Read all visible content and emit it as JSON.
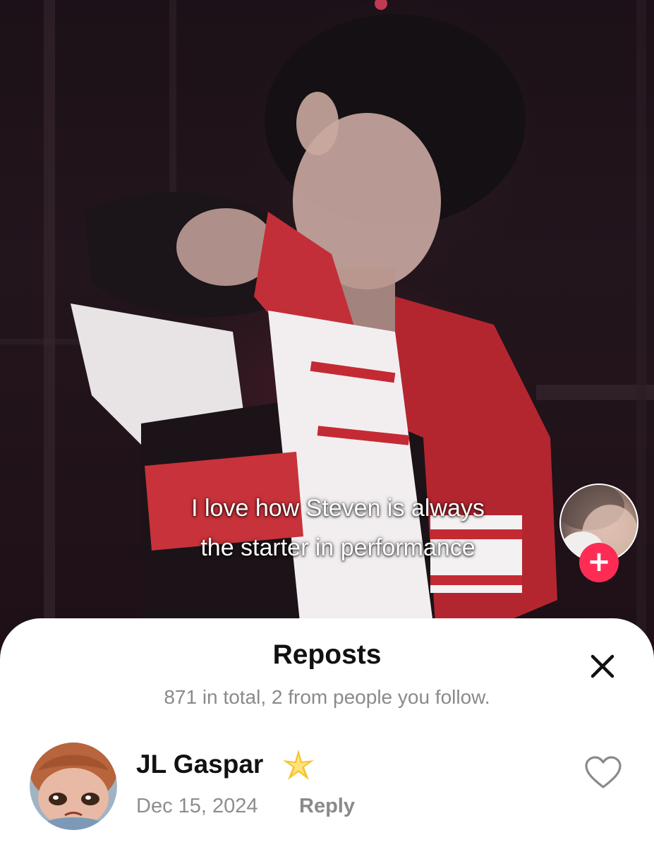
{
  "video": {
    "caption_line1": "I love how Steven is always",
    "caption_line2": "the starter in performance",
    "creator_avatar_icon": "creator-avatar-photo",
    "follow_icon": "plus-icon",
    "follow_color": "#fe2c55"
  },
  "sheet": {
    "title": "Reposts",
    "subtitle": "871 in total, 2 from people you follow.",
    "close_icon": "close-icon"
  },
  "reposts": [
    {
      "name": "JL Gaspar",
      "badge_icon": "sparkle-star-icon",
      "date": "Dec 15, 2024",
      "reply_label": "Reply",
      "like_icon": "heart-outline-icon"
    }
  ],
  "colors": {
    "accent": "#fe2c55",
    "text_primary": "#111111",
    "text_secondary": "#8a8a8a",
    "sheet_bg": "#ffffff"
  }
}
